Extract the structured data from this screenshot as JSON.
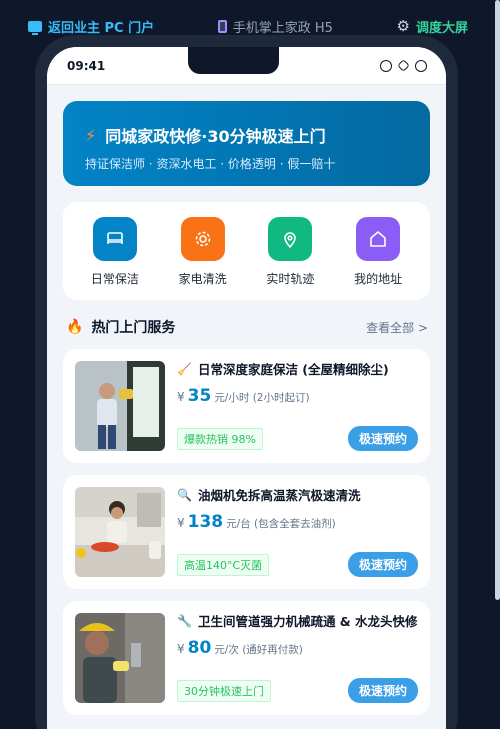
{
  "topnav": {
    "left": "返回业主 PC 门户",
    "middle": "手机掌上家政 H5",
    "right": "调度大屏"
  },
  "status_bar": {
    "time": "09:41"
  },
  "banner": {
    "title": "同城家政快修·30分钟极速上门",
    "subtitle": "持证保洁师 · 资深水电工 · 价格透明 · 假一赔十"
  },
  "quick_actions": [
    {
      "label": "日常保洁",
      "icon": "sofa-icon",
      "color": "#0284c7"
    },
    {
      "label": "家电清洗",
      "icon": "gear-icon",
      "color": "#f97316"
    },
    {
      "label": "实时轨迹",
      "icon": "location-pin-icon",
      "color": "#10b981"
    },
    {
      "label": "我的地址",
      "icon": "home-icon",
      "color": "#8b5cf6"
    }
  ],
  "section": {
    "title": "热门上门服务",
    "view_all": "查看全部 >"
  },
  "services": [
    {
      "title": "日常深度家庭保洁 (全屋精细除尘)",
      "icon": "broom-icon",
      "price": "35",
      "unit": "元/小时 (2小时起订)",
      "tag": "爆款热销 98%",
      "button": "极速预约"
    },
    {
      "title": "油烟机免拆高温蒸汽极速清洗",
      "icon": "magnifier-icon",
      "price": "138",
      "unit": "元/台 (包含全套去油剂)",
      "tag": "高温140°C灭菌",
      "button": "极速预约"
    },
    {
      "title": "卫生间管道强力机械疏通 & 水龙头快修",
      "icon": "wrench-icon",
      "price": "80",
      "unit": "元/次 (通好再付款)",
      "tag": "30分钟极速上门",
      "button": "极速预约"
    }
  ],
  "currency": "¥"
}
